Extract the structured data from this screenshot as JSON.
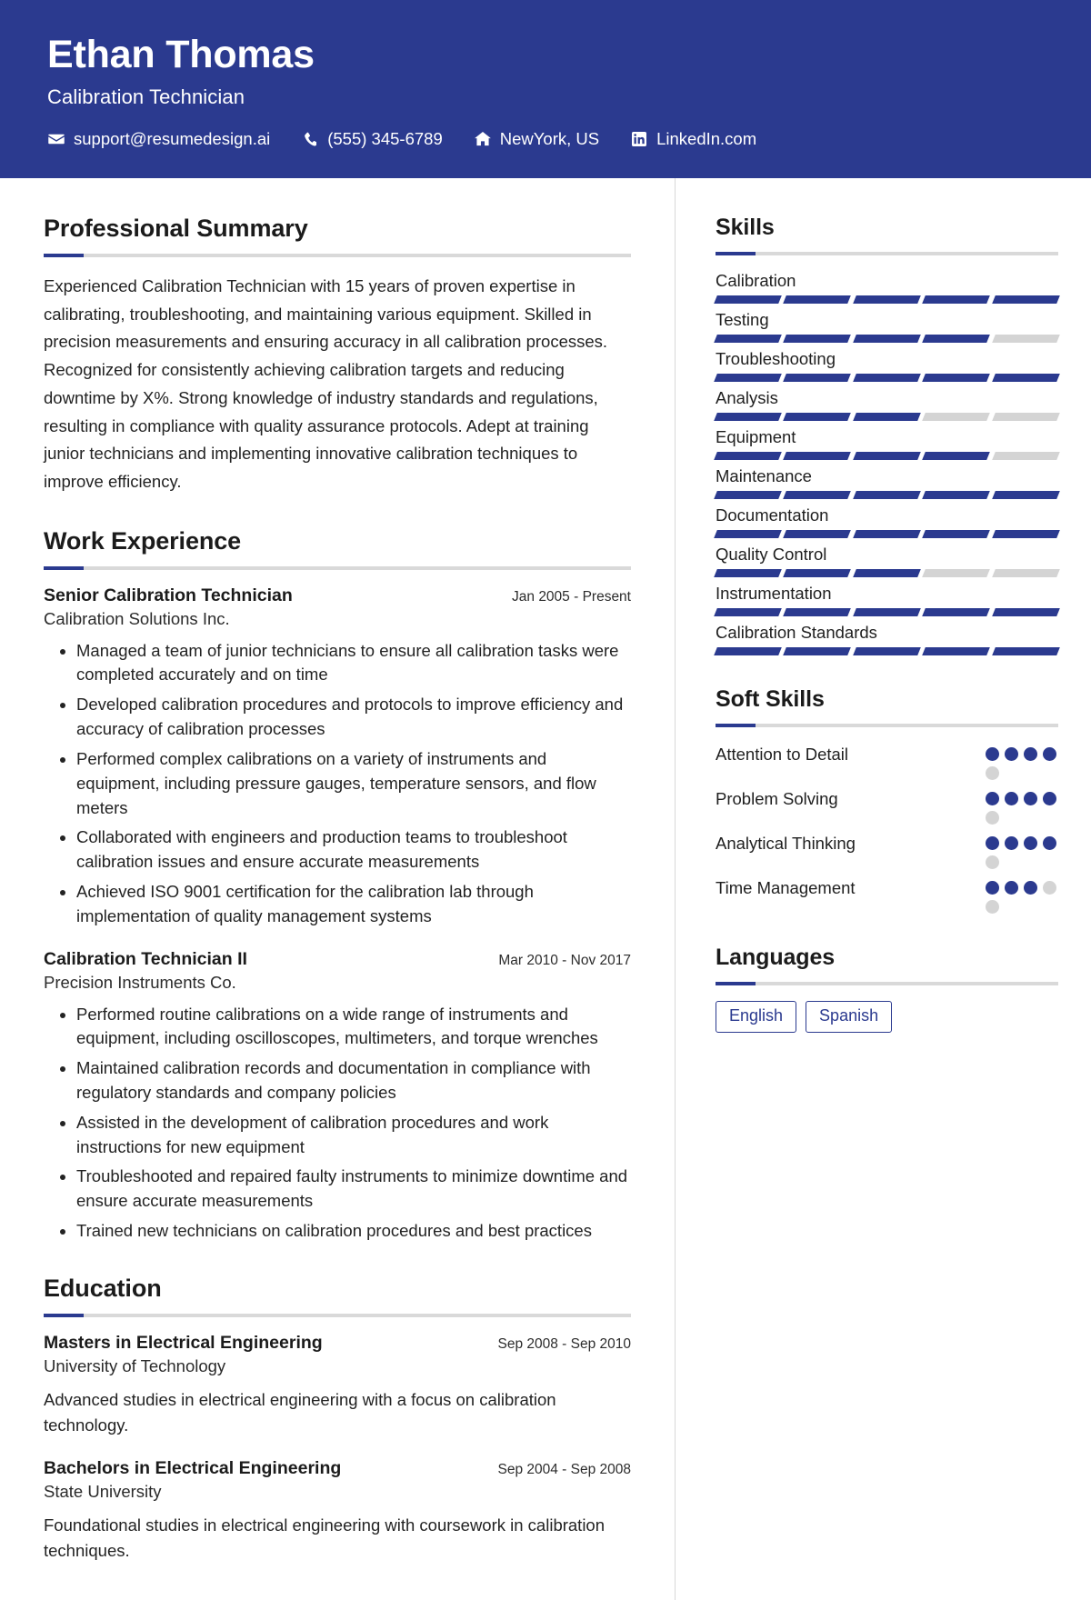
{
  "theme": {
    "accent": "#2b3a8f",
    "track": "#d4d4d4",
    "rule": "#d9d9d9"
  },
  "header": {
    "name": "Ethan Thomas",
    "job_title": "Calibration Technician",
    "contacts": [
      {
        "icon": "envelope-icon",
        "text": "support@resumedesign.ai"
      },
      {
        "icon": "phone-icon",
        "text": "(555) 345-6789"
      },
      {
        "icon": "home-icon",
        "text": "NewYork, US"
      },
      {
        "icon": "linkedin-icon",
        "text": "LinkedIn.com"
      }
    ]
  },
  "summary": {
    "title": "Professional Summary",
    "text": "Experienced Calibration Technician with 15 years of proven expertise in calibrating, troubleshooting, and maintaining various equipment. Skilled in precision measurements and ensuring accuracy in all calibration processes. Recognized for consistently achieving calibration targets and reducing downtime by X%. Strong knowledge of industry standards and regulations, resulting in compliance with quality assurance protocols. Adept at training junior technicians and implementing innovative calibration techniques to improve efficiency."
  },
  "experience": {
    "title": "Work Experience",
    "entries": [
      {
        "role": "Senior Calibration Technician",
        "dates": "Jan 2005 - Present",
        "org": "Calibration Solutions Inc.",
        "bullets": [
          "Managed a team of junior technicians to ensure all calibration tasks were completed accurately and on time",
          "Developed calibration procedures and protocols to improve efficiency and accuracy of calibration processes",
          "Performed complex calibrations on a variety of instruments and equipment, including pressure gauges, temperature sensors, and flow meters",
          "Collaborated with engineers and production teams to troubleshoot calibration issues and ensure accurate measurements",
          "Achieved ISO 9001 certification for the calibration lab through implementation of quality management systems"
        ]
      },
      {
        "role": "Calibration Technician II",
        "dates": "Mar 2010 - Nov 2017",
        "org": "Precision Instruments Co.",
        "bullets": [
          "Performed routine calibrations on a wide range of instruments and equipment, including oscilloscopes, multimeters, and torque wrenches",
          "Maintained calibration records and documentation in compliance with regulatory standards and company policies",
          "Assisted in the development of calibration procedures and work instructions for new equipment",
          "Troubleshooted and repaired faulty instruments to minimize downtime and ensure accurate measurements",
          "Trained new technicians on calibration procedures and best practices"
        ]
      }
    ]
  },
  "education": {
    "title": "Education",
    "entries": [
      {
        "degree": "Masters in Electrical Engineering",
        "dates": "Sep 2008 - Sep 2010",
        "school": "University of Technology",
        "description": "Advanced studies in electrical engineering with a focus on calibration technology."
      },
      {
        "degree": "Bachelors in Electrical Engineering",
        "dates": "Sep 2004 - Sep 2008",
        "school": "State University",
        "description": "Foundational studies in electrical engineering with coursework in calibration techniques."
      }
    ]
  },
  "skills": {
    "title": "Skills",
    "segments_total": 5,
    "items": [
      {
        "label": "Calibration",
        "filled": 5
      },
      {
        "label": "Testing",
        "filled": 4
      },
      {
        "label": "Troubleshooting",
        "filled": 5
      },
      {
        "label": "Analysis",
        "filled": 3
      },
      {
        "label": "Equipment",
        "filled": 4
      },
      {
        "label": "Maintenance",
        "filled": 5
      },
      {
        "label": "Documentation",
        "filled": 5
      },
      {
        "label": "Quality Control",
        "filled": 3
      },
      {
        "label": "Instrumentation",
        "filled": 5
      },
      {
        "label": "Calibration Standards",
        "filled": 5
      }
    ]
  },
  "soft_skills": {
    "title": "Soft Skills",
    "dots_total": 5,
    "items": [
      {
        "label": "Attention to Detail",
        "filled": 4
      },
      {
        "label": "Problem Solving",
        "filled": 4
      },
      {
        "label": "Analytical Thinking",
        "filled": 4
      },
      {
        "label": "Time Management",
        "filled": 3
      }
    ]
  },
  "languages": {
    "title": "Languages",
    "items": [
      "English",
      "Spanish"
    ]
  }
}
